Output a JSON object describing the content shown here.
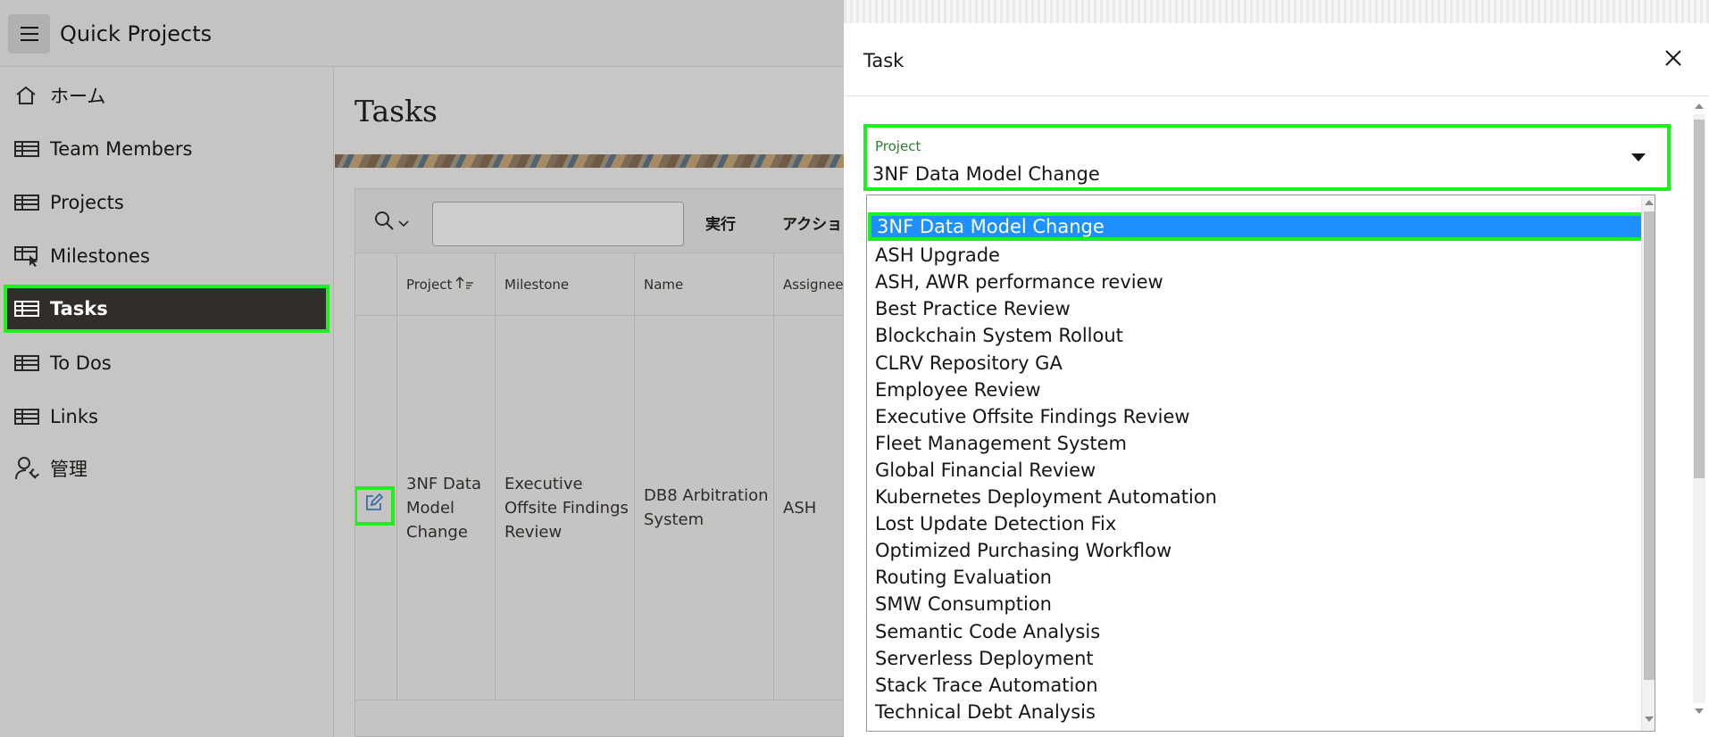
{
  "app": {
    "title": "Quick Projects"
  },
  "sidebar": {
    "items": [
      {
        "label": "ホーム",
        "icon": "home-icon"
      },
      {
        "label": "Team Members",
        "icon": "table-icon"
      },
      {
        "label": "Projects",
        "icon": "table-icon"
      },
      {
        "label": "Milestones",
        "icon": "milestone-icon"
      },
      {
        "label": "Tasks",
        "icon": "table-icon",
        "active": true
      },
      {
        "label": "To Dos",
        "icon": "table-icon"
      },
      {
        "label": "Links",
        "icon": "table-icon"
      },
      {
        "label": "管理",
        "icon": "user-wrench-icon"
      }
    ]
  },
  "main": {
    "title": "Tasks",
    "toolbar": {
      "go_label": "実行",
      "actions_label": "アクション"
    },
    "columns": [
      "Project",
      "Milestone",
      "Name",
      "Assignee"
    ],
    "row": {
      "project": "3NF Data Model Change",
      "milestone": "Executive Offsite Findings Review",
      "name": "DB8 Arbitration System",
      "assignee": "ASH"
    }
  },
  "dialog": {
    "title": "Task",
    "field": {
      "label": "Project",
      "value": "3NF Data Model Change"
    },
    "options": [
      "3NF Data Model Change",
      "ASH Upgrade",
      "ASH, AWR performance review",
      "Best Practice Review",
      "Blockchain System Rollout",
      "CLRV Repository GA",
      "Employee Review",
      "Executive Offsite Findings Review",
      "Fleet Management System",
      "Global Financial Review",
      "Kubernetes Deployment Automation",
      "Lost Update Detection Fix",
      "Optimized Purchasing Workflow",
      "Routing Evaluation",
      "SMW Consumption",
      "Semantic Code Analysis",
      "Serverless Deployment",
      "Stack Trace Automation",
      "Technical Debt Analysis"
    ],
    "selected_index": 0
  },
  "colors": {
    "highlight": "#1ef01e",
    "selection": "#1e90ff",
    "active_nav": "#312d2a"
  }
}
